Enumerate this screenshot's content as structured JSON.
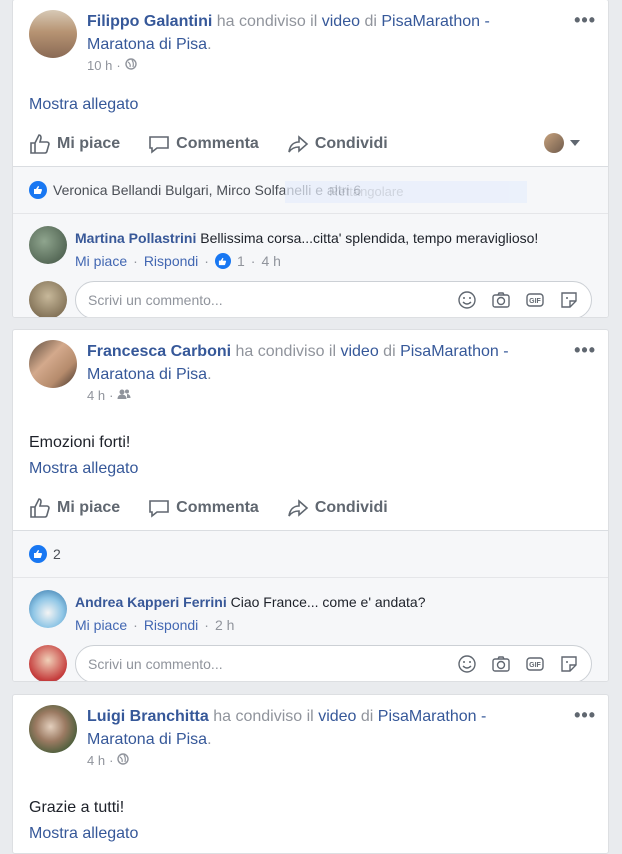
{
  "posts": [
    {
      "author": "Filippo Galantini",
      "shared_text": "ha condiviso il",
      "video_text": "video",
      "of_text": "di",
      "page": "PisaMarathon - Maratona di Pisa",
      "dot": ".",
      "time": "10 h",
      "privacy_icon": "globe-icon",
      "text": "",
      "attachment": "Mostra allegato",
      "like": "Mi piace",
      "comment": "Commenta",
      "share": "Condividi",
      "reactions": "Veronica Bellandi Bulgari, Mirco Solfanelli e altri 6",
      "ghost": "Rettangolare",
      "comment_item": {
        "name": "Martina Pollastrini",
        "text": "Bellissima corsa...citta' splendida, tempo meraviglioso!",
        "like": "Mi piace",
        "reply": "Rispondi",
        "likes": "1",
        "time": "4 h"
      },
      "placeholder": "Scrivi un commento..."
    },
    {
      "author": "Francesca Carboni",
      "shared_text": "ha condiviso il",
      "video_text": "video",
      "of_text": "di",
      "page": "PisaMarathon - Maratona di Pisa",
      "dot": ".",
      "time": "4 h",
      "privacy_icon": "friends-icon",
      "text": "Emozioni forti!",
      "attachment": "Mostra allegato",
      "like": "Mi piace",
      "comment": "Commenta",
      "share": "Condividi",
      "reactions_count": "2",
      "comment_item": {
        "name": "Andrea Kapperi Ferrini",
        "text": "Ciao France... come e' andata?",
        "like": "Mi piace",
        "reply": "Rispondi",
        "time": "2 h"
      },
      "placeholder": "Scrivi un commento..."
    },
    {
      "author": "Luigi Branchitta",
      "shared_text": "ha condiviso il",
      "video_text": "video",
      "of_text": "di",
      "page": "PisaMarathon - Maratona di Pisa",
      "dot": ".",
      "time": "4 h",
      "privacy_icon": "globe-icon",
      "text": "Grazie a tutti!",
      "attachment": "Mostra allegato"
    }
  ],
  "sep": "·"
}
